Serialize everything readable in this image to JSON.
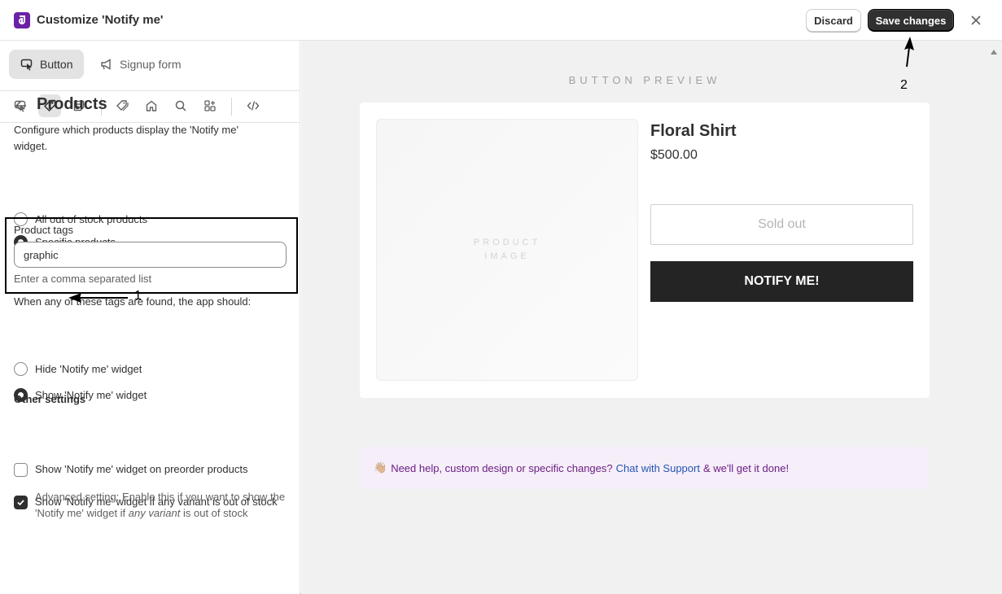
{
  "header": {
    "title": "Customize 'Notify me'",
    "discard_label": "Discard",
    "save_label": "Save changes"
  },
  "sidebar": {
    "tabs": [
      {
        "label": "Button",
        "icon": "cursor-click-icon",
        "active": true
      },
      {
        "label": "Signup form",
        "icon": "megaphone-icon",
        "active": false
      }
    ],
    "toolbar_icons": [
      "cursor-icon",
      "tag-icon",
      "note-icon",
      "tags-icon",
      "home-icon",
      "search-icon",
      "apps-icon",
      "code-icon"
    ],
    "section_title": "Products",
    "description": "Configure which products display the 'Notify me' widget.",
    "scope_options": [
      {
        "label": "All out of stock products",
        "selected": false
      },
      {
        "label": "Specific products",
        "selected": true
      }
    ],
    "product_tags": {
      "label": "Product tags",
      "value": "graphic",
      "help": "Enter a comma separated list"
    },
    "when_text": "When any of these tags are found, the app should:",
    "tag_action_options": [
      {
        "label": "Hide 'Notify me' widget",
        "selected": false
      },
      {
        "label": "Show 'Notify me' widget",
        "selected": true
      }
    ],
    "other_settings": {
      "heading": "Other settings",
      "preorder_label": "Show 'Notify me' widget on preorder products",
      "preorder_checked": false,
      "variant_label": "Show 'Notify me' widget if any variant is out of stock",
      "variant_checked": true,
      "advanced_help_prefix": "Advanced setting: Enable this if you want to show the 'Notify me' widget if ",
      "advanced_help_emphasis": "any variant",
      "advanced_help_suffix": " is out of stock"
    }
  },
  "preview": {
    "label": "BUTTON PREVIEW",
    "image_label_line1": "PRODUCT",
    "image_label_line2": "IMAGE",
    "product_name": "Floral Shirt",
    "product_price": "$500.00",
    "sold_out_label": "Sold out",
    "notify_label": "NOTIFY ME!",
    "help_emoji": "👋🏼",
    "help_prefix": "Need help, custom design or specific changes?",
    "help_link": "Chat with Support",
    "help_suffix": "& we'll get it done!"
  },
  "annotations": {
    "one": "1",
    "two": "2"
  },
  "colors": {
    "brand": "#6b21a8",
    "primary_button": "#303030",
    "notify_button": "#242424",
    "help_background": "#f6eef8",
    "help_text": "#6b1f86",
    "link": "#2455b5"
  }
}
